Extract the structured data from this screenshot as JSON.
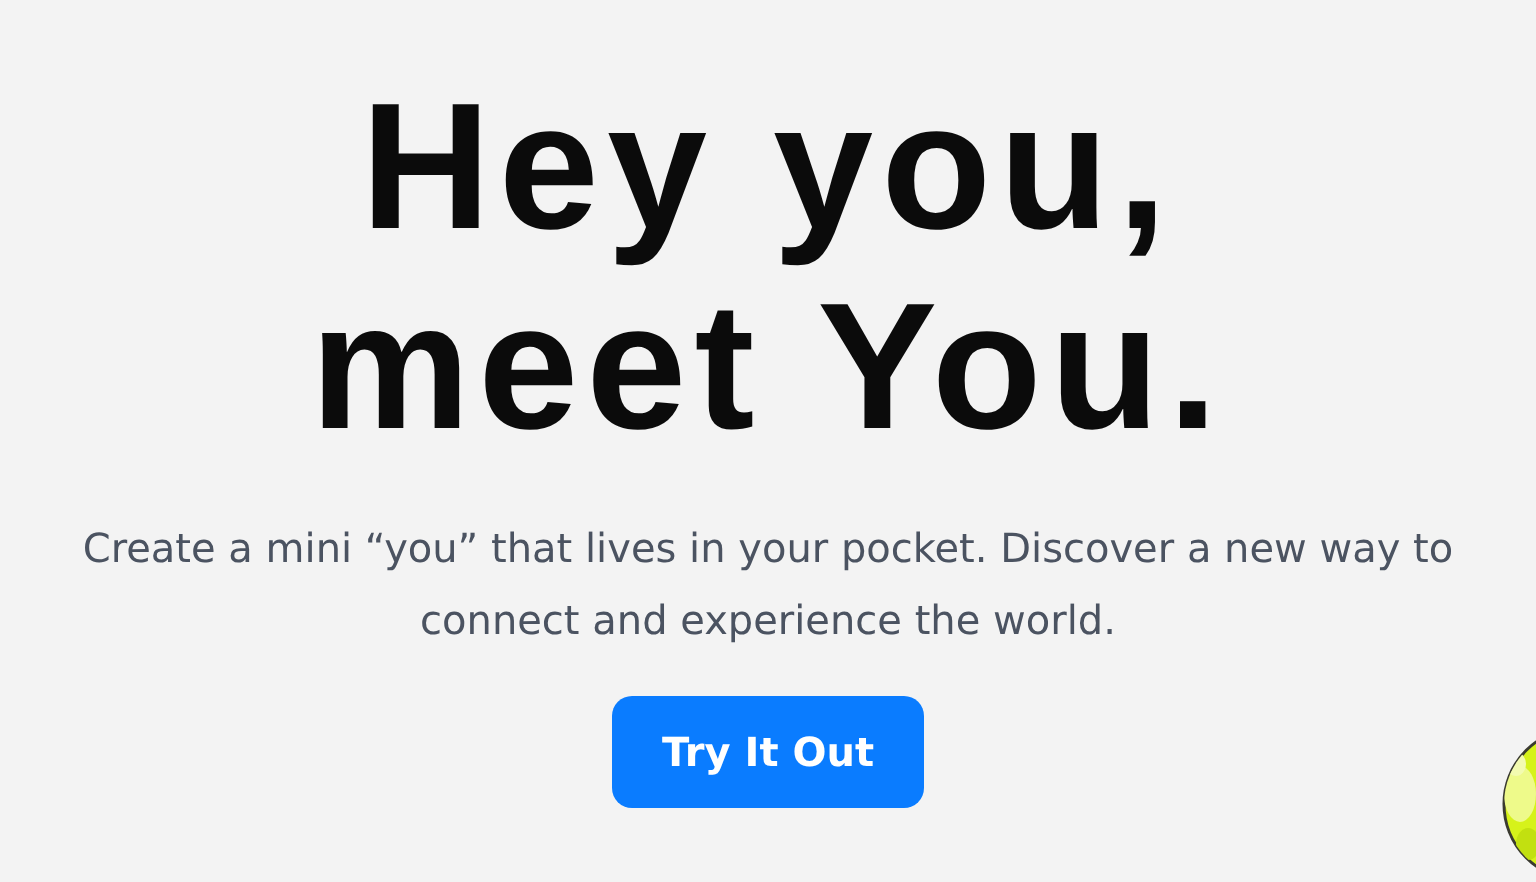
{
  "hero": {
    "headline_lines": [
      "Hey you,",
      "meet You."
    ],
    "description": "Create a mini “you” that lives in your pocket. Discover a new way to connect and experience the world.",
    "button": "Try It Out"
  }
}
